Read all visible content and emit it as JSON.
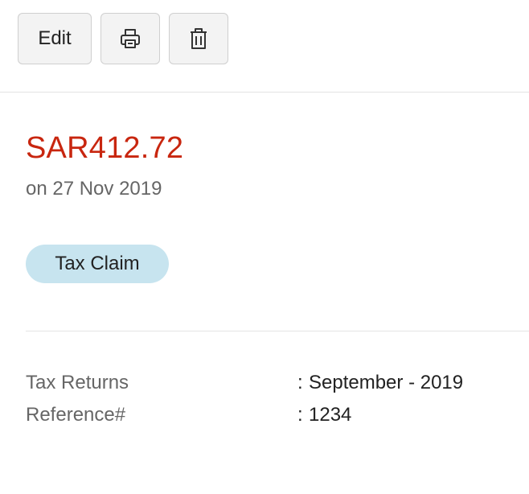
{
  "toolbar": {
    "edit_label": "Edit",
    "print_icon": "printer-icon",
    "delete_icon": "trash-icon"
  },
  "summary": {
    "amount": "SAR412.72",
    "date": "on 27 Nov 2019",
    "amount_color": "#c8260f"
  },
  "badge": {
    "label": "Tax Claim",
    "color": "#c7e4ef"
  },
  "details": {
    "rows": [
      {
        "label": "Tax Returns",
        "separator": ":",
        "value": "September - 2019"
      },
      {
        "label": "Reference#",
        "separator": ":",
        "value": "1234"
      }
    ]
  }
}
